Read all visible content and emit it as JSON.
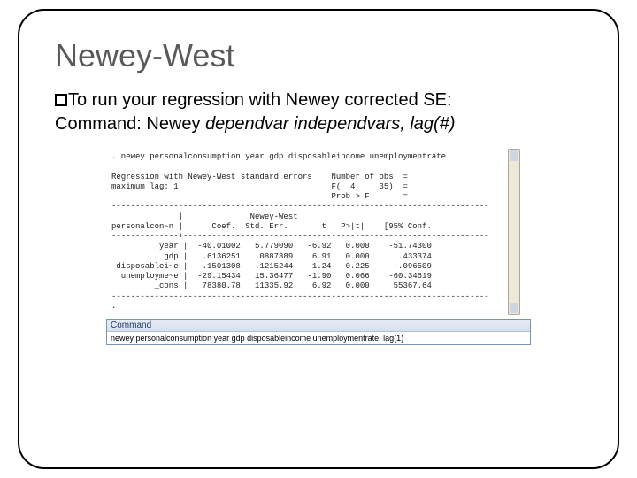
{
  "title": "Newey-West",
  "bullet": "To run your regression with Newey corrected SE:",
  "command_line_prefix": "Command: Newey ",
  "command_line_args": "dependvar independvars, lag(#)",
  "stata": {
    "cmd": ". newey personalconsumption year gdp disposableincome unemploymentrate",
    "reg_line": "Regression with Newey-West standard errors",
    "lag_line": "maximum lag: 1",
    "nobs_label": "Number of obs  =",
    "f_label": "F(  4,    35)  =",
    "p_label": "Prob > F       =",
    "hdr_dep": "personalcon~n",
    "hdr_coef": "Coef.",
    "hdr_se": "Std. Err.",
    "hdr_t": "t",
    "hdr_p": "P>|t|",
    "hdr_ci": "[95% Conf.",
    "se_title": "Newey-West",
    "rows": [
      {
        "name": "year",
        "coef": "-40.01002",
        "se": "5.779090",
        "t": "-6.92",
        "p": "0.000",
        "ci": "-51.74300"
      },
      {
        "name": "gdp",
        "coef": ".6136251",
        "se": ".0887889",
        "t": "6.91",
        "p": "0.000",
        "ci": ".433374"
      },
      {
        "name": "disposablei~e",
        "coef": ".1501308",
        "se": ".1215244",
        "t": "1.24",
        "p": "0.225",
        "ci": "-.096509"
      },
      {
        "name": "unemployme~e",
        "coef": "-29.15434",
        "se": "15.36477",
        "t": "-1.90",
        "p": "0.066",
        "ci": "-60.34619"
      },
      {
        "name": "_cons",
        "coef": "78380.78",
        "se": "11335.92",
        "t": "6.92",
        "p": "0.000",
        "ci": "55367.64"
      }
    ],
    "command_panel_title": "Command",
    "command_input": "newey personalconsumption year gdp disposableincome unemploymentrate, lag(1)"
  }
}
